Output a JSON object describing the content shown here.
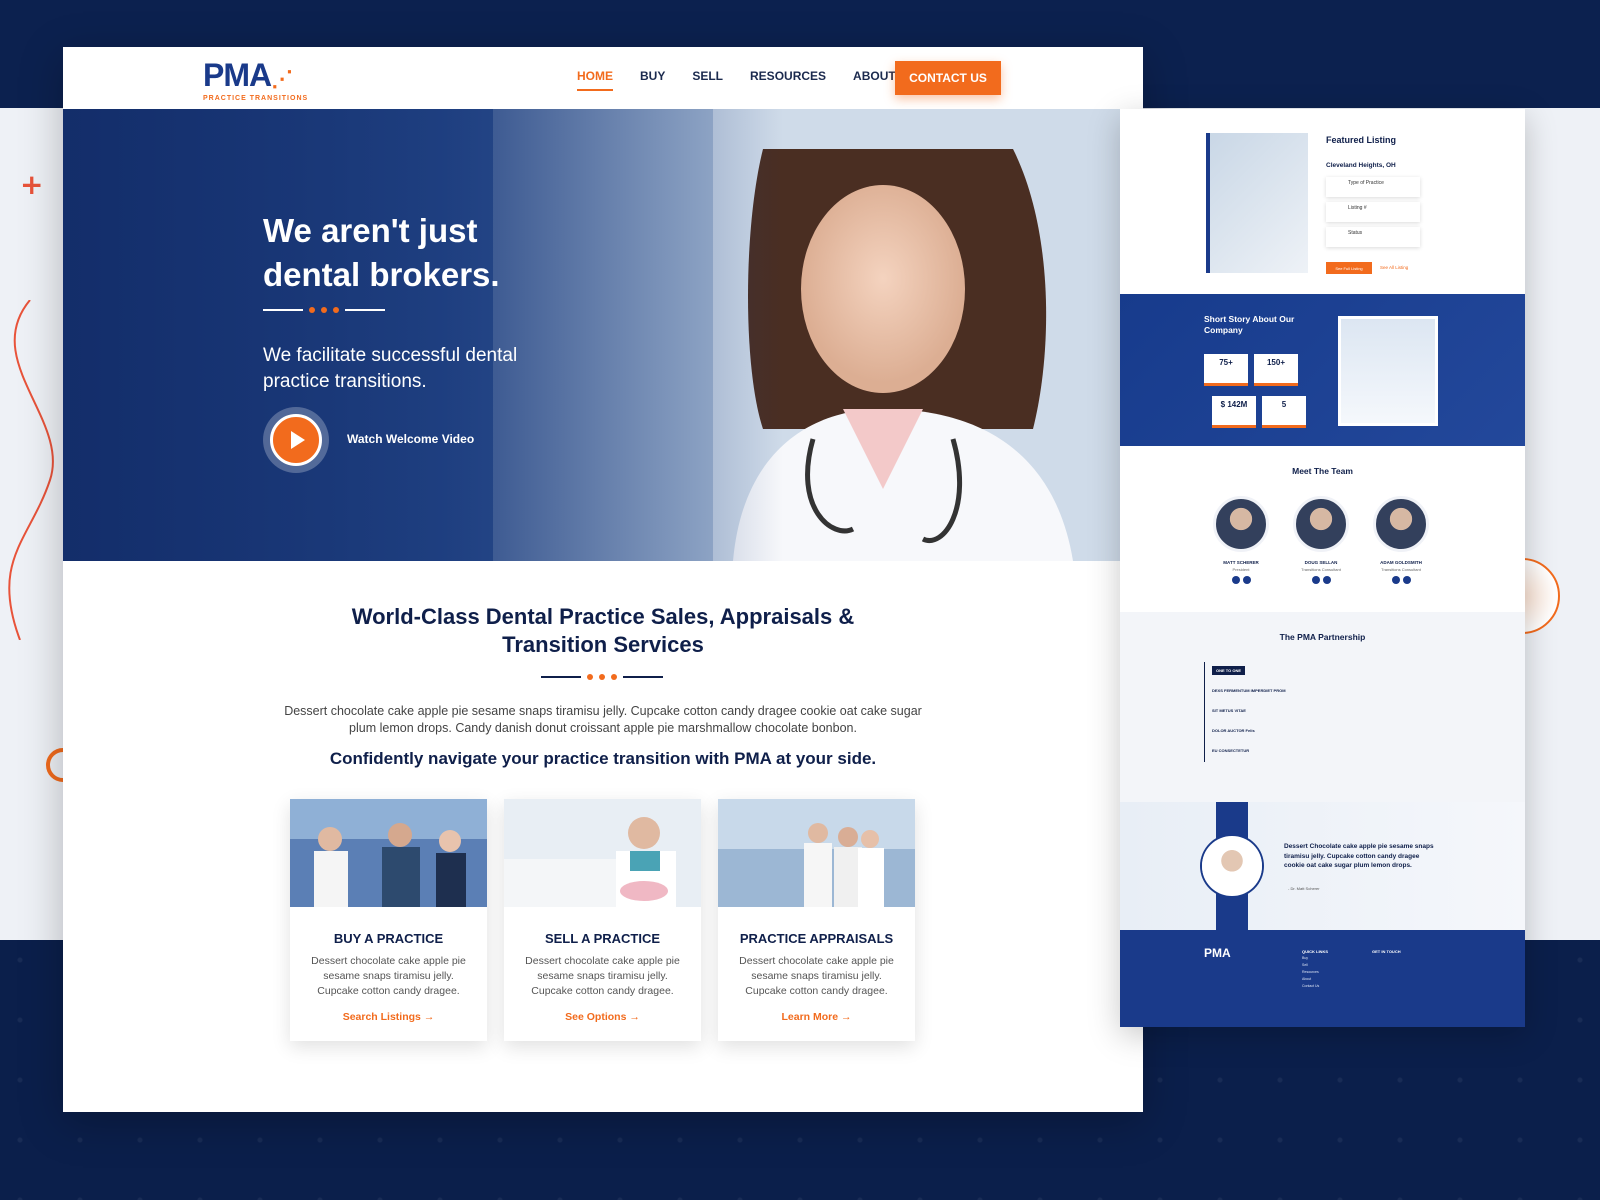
{
  "brand": {
    "logo_text": "PMA",
    "logo_sub": "PRACTICE TRANSITIONS",
    "accent_color": "#f26b1d",
    "navy_color": "#1a3a8a"
  },
  "nav": {
    "items": [
      {
        "label": "HOME",
        "active": true
      },
      {
        "label": "BUY",
        "active": false
      },
      {
        "label": "SELL",
        "active": false
      },
      {
        "label": "RESOURCES",
        "active": false
      },
      {
        "label": "ABOUT",
        "active": false
      }
    ],
    "contact_label": "CONTACT US"
  },
  "hero": {
    "title": "We aren't just dental brokers.",
    "subtitle": "We facilitate successful dental practice transitions.",
    "video_label": "Watch Welcome Video",
    "play_icon": "play-icon"
  },
  "services": {
    "title_line1": "World-Class Dental Practice Sales, Appraisals &",
    "title_line2": "Transition Services",
    "description": "Dessert chocolate cake apple pie sesame snaps tiramisu jelly. Cupcake cotton candy dragee cookie oat cake sugar plum lemon drops. Candy danish donut croissant apple pie marshmallow chocolate bonbon.",
    "tagline": "Confidently navigate your practice transition with PMA at your side.",
    "cards": [
      {
        "title": "BUY A PRACTICE",
        "text": "Dessert chocolate cake apple pie sesame snaps tiramisu jelly. Cupcake cotton candy dragee.",
        "link": "Search Listings"
      },
      {
        "title": "SELL A PRACTICE",
        "text": "Dessert chocolate cake apple pie sesame snaps tiramisu jelly. Cupcake cotton candy dragee.",
        "link": "See Options"
      },
      {
        "title": "PRACTICE APPRAISALS",
        "text": "Dessert chocolate cake apple pie sesame snaps tiramisu jelly. Cupcake cotton candy dragee.",
        "link": "Learn More"
      }
    ]
  },
  "side": {
    "featured_title": "Featured Listing",
    "featured_city": "Cleveland Heights, OH",
    "featured_boxes": [
      "Type of Practice",
      "Listing #",
      "Status"
    ],
    "featured_btn": "See Full Listing",
    "featured_link": "See All Listing",
    "story_title": "Short Story About Our Company",
    "stats": [
      {
        "num": "75+"
      },
      {
        "num": "150+"
      },
      {
        "num": "$ 142M"
      },
      {
        "num": "5"
      }
    ],
    "team_title": "Meet The Team",
    "team": [
      {
        "name": "MATT SCHERER",
        "role": "President"
      },
      {
        "name": "DOUG SELLAN",
        "role": "Transitions Consultant"
      },
      {
        "name": "ADAM GOLDSMITH",
        "role": "Transitions Consultant"
      }
    ],
    "partnership_title": "The PMA Partnership",
    "steps": [
      "ONE TO ONE",
      "DEXS FERMENTUM IMPERDIET PROM",
      "SIT METUS VITAE",
      "DOLOR AUCTOR Felis",
      "EU CONSECTETUR"
    ],
    "testimonial": "Dessert Chocolate cake apple pie sesame snaps tiramisu jelly. Cupcake cotton candy dragee cookie oat cake sugar plum lemon drops.",
    "testimonial_author": "- Dr. Matt Scherer",
    "footer_logo": "PMA",
    "footer_quick": "QUICK LINKS",
    "footer_touch": "GET IN TOUCH",
    "footer_links": [
      "Buy",
      "Sell",
      "Resources",
      "About",
      "Contact Us"
    ]
  }
}
